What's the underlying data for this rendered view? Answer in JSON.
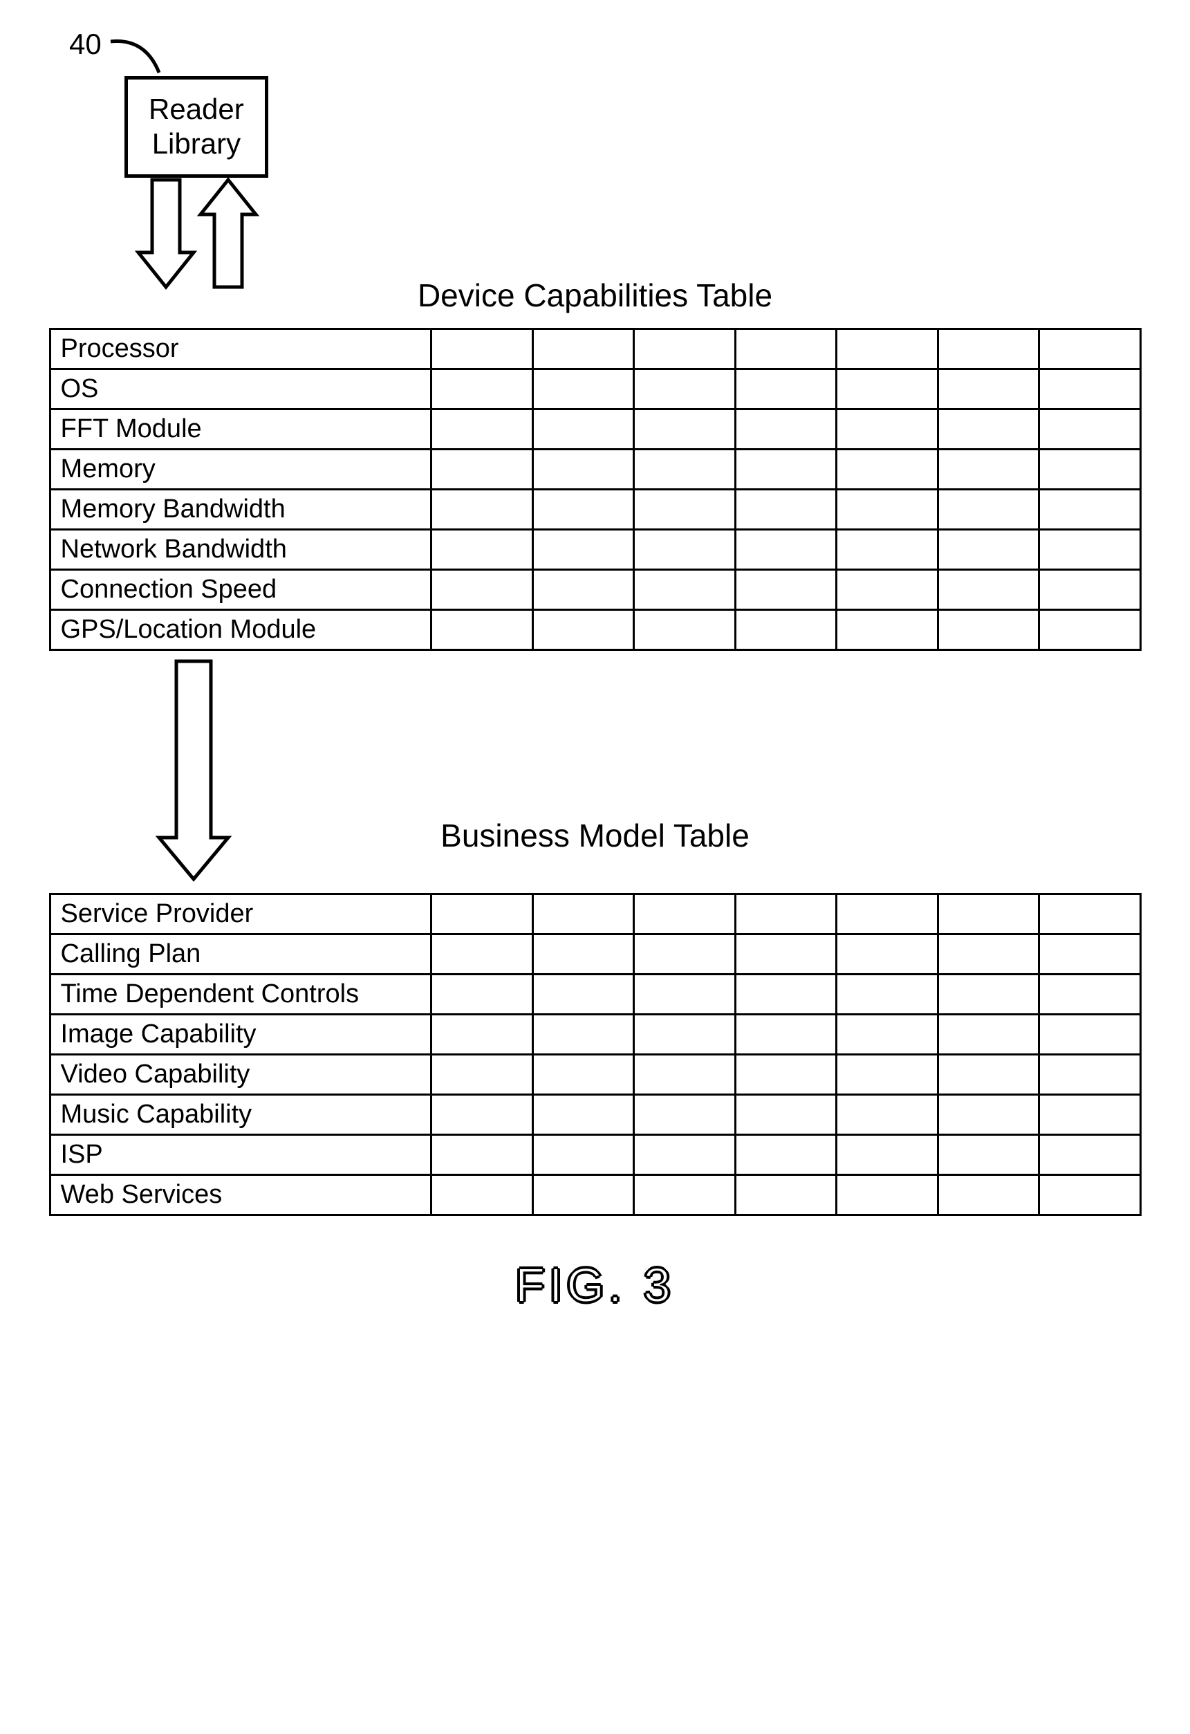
{
  "ref": {
    "number": "40"
  },
  "reader_box": {
    "line1": "Reader",
    "line2": "Library"
  },
  "table1": {
    "title": "Device Capabilities Table",
    "rows": [
      "Processor",
      "OS",
      "FFT Module",
      "Memory",
      "Memory Bandwidth",
      "Network Bandwidth",
      "Connection Speed",
      "GPS/Location Module"
    ]
  },
  "table2": {
    "title": "Business Model Table",
    "rows": [
      "Service Provider",
      "Calling Plan",
      "Time Dependent Controls",
      "Image Capability",
      "Video Capability",
      "Music Capability",
      "ISP",
      "Web Services"
    ]
  },
  "figure": {
    "caption": "FIG. 3"
  },
  "chart_data": {
    "type": "table",
    "title": "FIG. 3 — Reader Library feeds Device Capabilities Table which feeds Business Model Table",
    "tables": [
      {
        "name": "Device Capabilities Table",
        "row_headers": [
          "Processor",
          "OS",
          "FFT Module",
          "Memory",
          "Memory Bandwidth",
          "Network Bandwidth",
          "Connection Speed",
          "GPS/Location Module"
        ],
        "data_columns": 7,
        "cells_empty": true
      },
      {
        "name": "Business Model Table",
        "row_headers": [
          "Service Provider",
          "Calling Plan",
          "Time Dependent Controls",
          "Image Capability",
          "Video Capability",
          "Music Capability",
          "ISP",
          "Web Services"
        ],
        "data_columns": 7,
        "cells_empty": true
      }
    ],
    "flow": [
      "Reader Library (40)",
      "Device Capabilities Table",
      "Business Model Table"
    ]
  }
}
